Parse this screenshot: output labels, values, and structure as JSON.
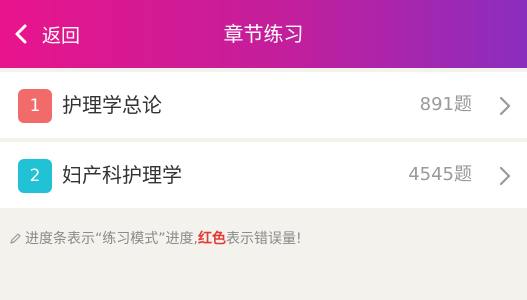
{
  "header": {
    "back_label": "返回",
    "title": "章节练习",
    "gradient_colors": [
      "#e8148c",
      "#8b2dbf"
    ]
  },
  "chapters": [
    {
      "index": "1",
      "name": "护理学总论",
      "count": "891题",
      "badge_color": "#f26b6b"
    },
    {
      "index": "2",
      "name": "妇产科护理学",
      "count": "4545题",
      "badge_color": "#22c2d6"
    }
  ],
  "note": {
    "icon": "pencil-icon",
    "prefix": "进度条表示“练习模式”进度,",
    "highlight": "红色",
    "suffix": "表示错误量!",
    "highlight_color": "#e53935"
  }
}
